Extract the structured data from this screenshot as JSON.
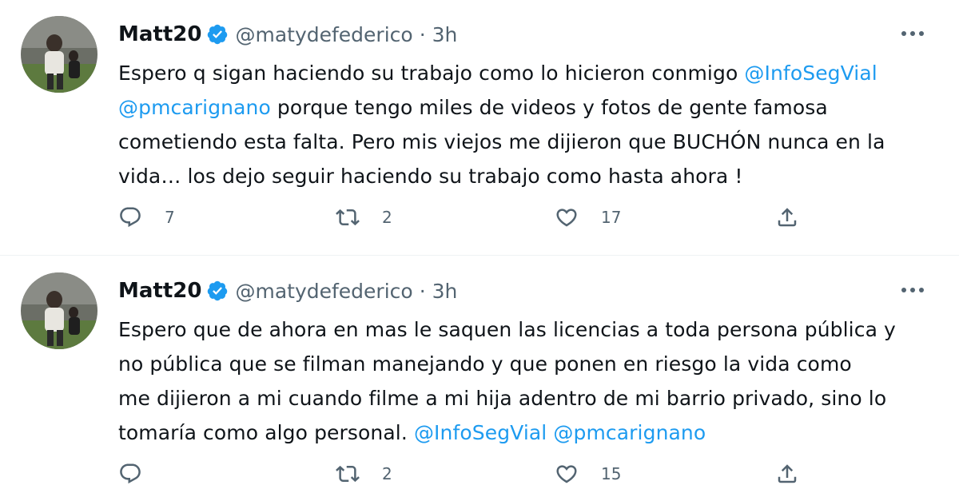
{
  "tweets": [
    {
      "name": "Matt20",
      "handle": "@matydefederico",
      "separator": "·",
      "time": "3h",
      "lines": [
        [
          {
            "t": "Espero q sigan haciendo su trabajo como lo hicieron conmigo "
          },
          {
            "t": "@InfoSegVial",
            "mention": true
          }
        ],
        [
          {
            "t": "@pmcarignano",
            "mention": true
          },
          {
            "t": " porque tengo miles de videos y fotos de gente famosa"
          }
        ],
        [
          {
            "t": "cometiendo esta falta. Pero mis viejos me dijieron que BUCHÓN nunca en la"
          }
        ],
        [
          {
            "t": "vida… los dejo seguir haciendo su trabajo como hasta ahora !"
          }
        ]
      ],
      "replies": "7",
      "retweets": "2",
      "likes": "17"
    },
    {
      "name": "Matt20",
      "handle": "@matydefederico",
      "separator": "·",
      "time": "3h",
      "lines": [
        [
          {
            "t": "Espero que de ahora en mas le saquen las licencias a toda persona pública y"
          }
        ],
        [
          {
            "t": "no pública que se filman manejando y que ponen en riesgo la vida como"
          }
        ],
        [
          {
            "t": "me dijieron a mi cuando filme a mi hija adentro de mi barrio privado, sino lo"
          }
        ],
        [
          {
            "t": "tomaría como algo personal. "
          },
          {
            "t": "@InfoSegVial",
            "mention": true
          },
          {
            "t": " "
          },
          {
            "t": "@pmcarignano",
            "mention": true
          }
        ]
      ],
      "replies": "",
      "retweets": "2",
      "likes": "15"
    }
  ],
  "colors": {
    "accent": "#1d9bf0",
    "secondary_text": "#536471",
    "text": "#0f1419",
    "divider": "#eff3f4"
  },
  "icons": {
    "verified": "verified-badge-icon",
    "more": "more-icon",
    "reply": "reply-icon",
    "retweet": "retweet-icon",
    "like": "like-icon",
    "share": "share-icon"
  }
}
